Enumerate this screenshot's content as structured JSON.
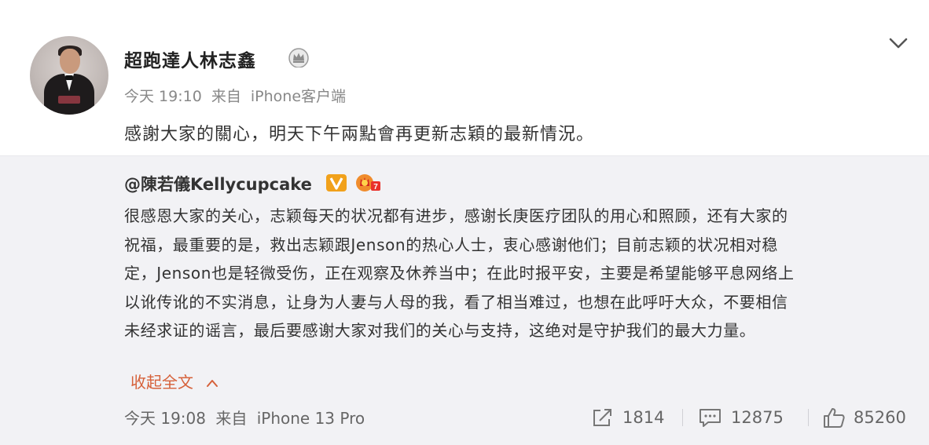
{
  "post": {
    "username": "超跑達人林志鑫",
    "time": "今天 19:10",
    "source_prefix": "来自",
    "source": "iPhone客户端",
    "text": "感謝大家的關心，明天下午兩點會再更新志穎的最新情況。"
  },
  "repost": {
    "author": "@陳若儀Kellycupcake",
    "body_lines": [
      "很感恩大家的关心，志颖每天的状况都有进步，感谢长庚医疗团队的用心和照顾，还有大家的",
      "祝福，最重要的是，救出志颖跟Jenson的热心人士，衷心感谢他们；目前志颖的状况相对稳",
      "定，Jenson也是轻微受伤，正在观察及休养当中；在此时报平安，主要是希望能够平息网络上",
      "以讹传讹的不实消息，让身为人妻与人母的我，看了相当难过，也想在此呼吁大众，不要相信",
      "未经求证的谣言，最后要感谢大家对我们的关心与支持，这绝对是守护我们的最大力量。"
    ],
    "collapse_label": "收起全文",
    "time": "今天 19:08",
    "source_prefix": "来自",
    "source": "iPhone 13 Pro",
    "repost_count": "1814",
    "comment_count": "12875",
    "like_count": "85260"
  },
  "icons": {
    "crown": "crown-icon",
    "chevron": "chevron-down-icon",
    "verified": "verified-v-icon",
    "vip": "vip-badge-icon",
    "share": "share-icon",
    "comment": "comment-icon",
    "like": "thumbs-up-icon"
  },
  "colors": {
    "accent": "#d6613a",
    "verified": "#f1a11b",
    "vip": "#f08c2c",
    "repost_bg": "#f2f2f5"
  }
}
